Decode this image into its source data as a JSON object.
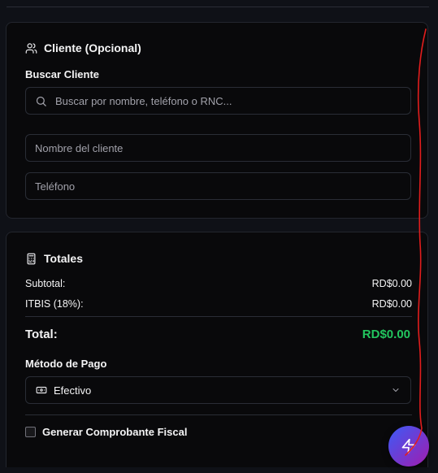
{
  "client_section": {
    "title": "Cliente (Opcional)",
    "search_label": "Buscar Cliente",
    "search_placeholder": "Buscar por nombre, teléfono o RNC...",
    "name_placeholder": "Nombre del cliente",
    "phone_placeholder": "Teléfono"
  },
  "totals_section": {
    "title": "Totales",
    "subtotal_label": "Subtotal:",
    "subtotal_value": "RD$0.00",
    "itbis_label": "ITBIS (18%):",
    "itbis_value": "RD$0.00",
    "total_label": "Total:",
    "total_value": "RD$0.00",
    "payment_method_label": "Método de Pago",
    "payment_method_selected": "Efectivo",
    "fiscal_receipt_label": "Generar Comprobante Fiscal"
  },
  "colors": {
    "background": "#0f1117",
    "card": "#09090b",
    "accent_total": "#22c55e",
    "fab_start": "#3b5bf6",
    "fab_end": "#a21caf",
    "annotation": "#e11d1d"
  },
  "icons": {
    "client": "users-icon",
    "search": "search-icon",
    "totals": "calculator-icon",
    "payment": "banknote-icon",
    "select": "chevron-down-icon",
    "fab": "zap-icon"
  }
}
